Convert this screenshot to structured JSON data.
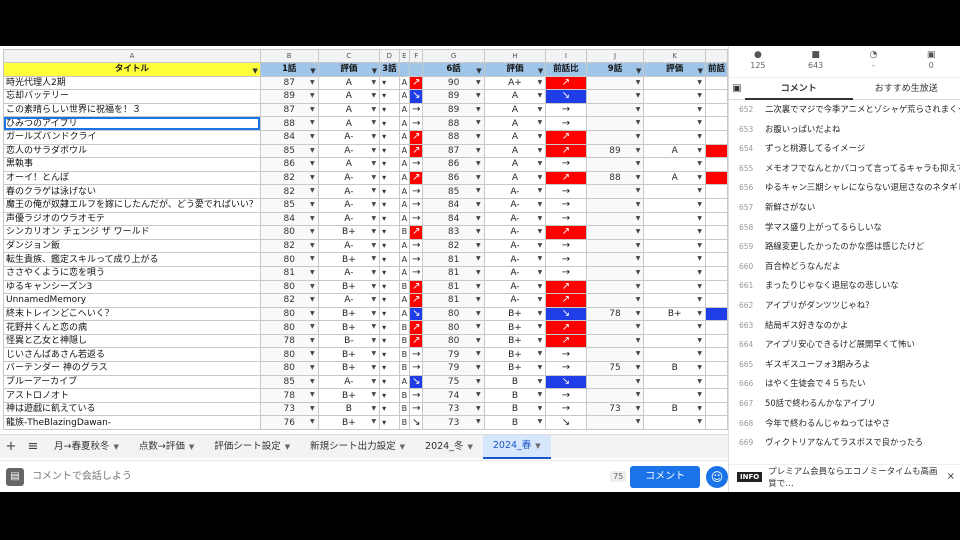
{
  "sheet": {
    "col_letters": [
      "A",
      "B",
      "C",
      "D",
      "E",
      "F",
      "G",
      "H",
      "I",
      "J",
      "K",
      ""
    ],
    "headers": [
      "タイトル",
      "1話",
      "評価",
      "3話",
      "",
      "",
      "6話",
      "評価",
      "前話比",
      "9話",
      "評価",
      "前話"
    ],
    "rows": [
      {
        "title": "時光代理人2期",
        "e1": "87",
        "g1": "A",
        "d": "A",
        "e6": "90",
        "g6": "A+",
        "cmp": "↗",
        "cmp_color": "red",
        "e9": "",
        "g9": ""
      },
      {
        "title": "忘却バッテリー",
        "e1": "89",
        "g1": "A",
        "d": "A",
        "e6": "89",
        "g6": "A",
        "cmp": "↘",
        "cmp_color": "blue",
        "e9": "",
        "g9": ""
      },
      {
        "title": "この素晴らしい世界に祝福を！３",
        "e1": "87",
        "g1": "A",
        "d": "A",
        "e6": "89",
        "g6": "A",
        "cmp": "→",
        "cmp_color": "",
        "e9": "",
        "g9": ""
      },
      {
        "title": "ひみつのアイプリ",
        "e1": "88",
        "g1": "A",
        "d": "A",
        "e6": "88",
        "g6": "A",
        "cmp": "→",
        "cmp_color": "",
        "e9": "",
        "g9": ""
      },
      {
        "title": "ガールズバンドクライ",
        "e1": "84",
        "g1": "A-",
        "d": "A",
        "e6": "88",
        "g6": "A",
        "cmp": "↗",
        "cmp_color": "red",
        "e9": "",
        "g9": ""
      },
      {
        "title": "恋人のサラダボウル",
        "e1": "85",
        "g1": "A-",
        "d": "A",
        "e6": "87",
        "g6": "A",
        "cmp": "↗",
        "cmp_color": "red",
        "e9": "89",
        "g9": "A"
      },
      {
        "title": "黒執事",
        "e1": "86",
        "g1": "A",
        "d": "A",
        "e6": "86",
        "g6": "A",
        "cmp": "→",
        "cmp_color": "",
        "e9": "",
        "g9": ""
      },
      {
        "title": "オーイ！とんぼ",
        "e1": "82",
        "g1": "A-",
        "d": "A",
        "e6": "86",
        "g6": "A",
        "cmp": "↗",
        "cmp_color": "red",
        "e9": "88",
        "g9": "A"
      },
      {
        "title": "春のクラゲは泳げない",
        "e1": "82",
        "g1": "A-",
        "d": "A",
        "e6": "85",
        "g6": "A-",
        "cmp": "→",
        "cmp_color": "",
        "e9": "",
        "g9": ""
      },
      {
        "title": "魔王の俺が奴隷エルフを嫁にしたんだが、どう愛でればいい？",
        "e1": "85",
        "g1": "A-",
        "d": "A",
        "e6": "84",
        "g6": "A-",
        "cmp": "→",
        "cmp_color": "",
        "e9": "",
        "g9": ""
      },
      {
        "title": "声優ラジオのウラオモテ",
        "e1": "84",
        "g1": "A-",
        "d": "A",
        "e6": "84",
        "g6": "A-",
        "cmp": "→",
        "cmp_color": "",
        "e9": "",
        "g9": ""
      },
      {
        "title": "シンカリオン チェンジ ザ ワールド",
        "e1": "80",
        "g1": "B+",
        "d": "B",
        "e6": "83",
        "g6": "A-",
        "cmp": "↗",
        "cmp_color": "red",
        "e9": "",
        "g9": ""
      },
      {
        "title": "ダンジョン飯",
        "e1": "82",
        "g1": "A-",
        "d": "A",
        "e6": "82",
        "g6": "A-",
        "cmp": "→",
        "cmp_color": "",
        "e9": "",
        "g9": ""
      },
      {
        "title": "転生貴族、鑑定スキルって成り上がる",
        "e1": "80",
        "g1": "B+",
        "d": "A",
        "e6": "81",
        "g6": "A-",
        "cmp": "→",
        "cmp_color": "",
        "e9": "",
        "g9": ""
      },
      {
        "title": "ささやくように恋を唄う",
        "e1": "81",
        "g1": "A-",
        "d": "A",
        "e6": "81",
        "g6": "A-",
        "cmp": "→",
        "cmp_color": "",
        "e9": "",
        "g9": ""
      },
      {
        "title": "ゆるキャンシーズン3",
        "e1": "80",
        "g1": "B+",
        "d": "B",
        "e6": "81",
        "g6": "A-",
        "cmp": "↗",
        "cmp_color": "red",
        "e9": "",
        "g9": ""
      },
      {
        "title": "UnnamedMemory",
        "e1": "82",
        "g1": "A-",
        "d": "A",
        "e6": "81",
        "g6": "A-",
        "cmp": "↗",
        "cmp_color": "red",
        "e9": "",
        "g9": ""
      },
      {
        "title": "終末トレインどこへいく？",
        "e1": "80",
        "g1": "B+",
        "d": "A",
        "e6": "80",
        "g6": "B+",
        "cmp": "↘",
        "cmp_color": "blue",
        "e9": "78",
        "g9": "B+"
      },
      {
        "title": "花野井くんと恋の病",
        "e1": "80",
        "g1": "B+",
        "d": "B",
        "e6": "80",
        "g6": "B+",
        "cmp": "↗",
        "cmp_color": "red",
        "e9": "",
        "g9": ""
      },
      {
        "title": "怪異と乙女と神隠し",
        "e1": "78",
        "g1": "B-",
        "d": "B",
        "e6": "80",
        "g6": "B+",
        "cmp": "↗",
        "cmp_color": "red",
        "e9": "",
        "g9": ""
      },
      {
        "title": "じいさんばあさん若返る",
        "e1": "80",
        "g1": "B+",
        "d": "B",
        "e6": "79",
        "g6": "B+",
        "cmp": "→",
        "cmp_color": "",
        "e9": "",
        "g9": ""
      },
      {
        "title": "バーテンダー 神のグラス",
        "e1": "80",
        "g1": "B+",
        "d": "B",
        "e6": "79",
        "g6": "B+",
        "cmp": "→",
        "cmp_color": "",
        "e9": "75",
        "g9": "B"
      },
      {
        "title": "ブルーアーカイブ",
        "e1": "85",
        "g1": "A-",
        "d": "A",
        "e6": "75",
        "g6": "B",
        "cmp": "↘",
        "cmp_color": "blue",
        "e9": "",
        "g9": ""
      },
      {
        "title": "アストロノオト",
        "e1": "78",
        "g1": "B+",
        "d": "B",
        "e6": "74",
        "g6": "B",
        "cmp": "→",
        "cmp_color": "",
        "e9": "",
        "g9": ""
      },
      {
        "title": "神は遊戯に飢えている",
        "e1": "73",
        "g1": "B",
        "d": "B",
        "e6": "73",
        "g6": "B",
        "cmp": "→",
        "cmp_color": "",
        "e9": "73",
        "g9": "B"
      },
      {
        "title": "龍族-TheBlazingDawan-",
        "e1": "76",
        "g1": "B+",
        "d": "B",
        "e6": "73",
        "g6": "B",
        "cmp": "↘",
        "cmp_color": "",
        "e9": "",
        "g9": ""
      }
    ]
  },
  "tabs": {
    "items": [
      "月→春夏秋冬",
      "点数→評価",
      "評価シート設定",
      "新規シート出力設定",
      "2024_冬",
      "2024_春"
    ],
    "active": "2024_春"
  },
  "comment_input": {
    "placeholder": "コメントで会話しよう",
    "count": "75",
    "send_label": "コメント"
  },
  "panel": {
    "stats": [
      {
        "icon": "person-icon",
        "value": "125"
      },
      {
        "icon": "comment-icon",
        "value": "643"
      },
      {
        "icon": "clock-icon",
        "value": "-"
      },
      {
        "icon": "gift-icon",
        "value": "0"
      }
    ],
    "tabs": [
      "コメント",
      "おすすめ生放送"
    ],
    "comments": [
      {
        "no": "652",
        "text": "二次裏でマジで今季アニメとゾシャゲ荒らされまくってて嘘"
      },
      {
        "no": "653",
        "text": "お腹いっぱいだよね"
      },
      {
        "no": "654",
        "text": "ずっと桃源してるイメージ"
      },
      {
        "no": "655",
        "text": "メモオフでなんとかパコって言ってるキャラも抑えてほしい"
      },
      {
        "no": "656",
        "text": "ゆるキャン三期シャレにならない退屈さなのネタギレ感じる"
      },
      {
        "no": "657",
        "text": "新鮮さがない"
      },
      {
        "no": "658",
        "text": "学マス盛り上がってるらしいな"
      },
      {
        "no": "659",
        "text": "路線変更したかったのかな感は感じたけど"
      },
      {
        "no": "660",
        "text": "百合枠どうなんだよ"
      },
      {
        "no": "661",
        "text": "まったりじゃなく退屈なの悲しいな"
      },
      {
        "no": "662",
        "text": "アイプリがダンツツじゃね？"
      },
      {
        "no": "663",
        "text": "結局ギス好きなのかよ"
      },
      {
        "no": "664",
        "text": "アイプリ安心できるけど展開早くて怖い"
      },
      {
        "no": "665",
        "text": "ギスギスユーフォ3期みろよ"
      },
      {
        "no": "666",
        "text": "はやく生徒会で４５ちたい"
      },
      {
        "no": "667",
        "text": "50話で終わるんかなアイプリ"
      },
      {
        "no": "668",
        "text": "今年で終わるんじゃねってはやさ"
      },
      {
        "no": "669",
        "text": "ヴィクトリアなんてラスボスで良かったろ"
      }
    ],
    "info_badge": "INFO",
    "info_text": "プレミアム会員ならエコノミータイムも高画質で…",
    "info_close": "×"
  }
}
